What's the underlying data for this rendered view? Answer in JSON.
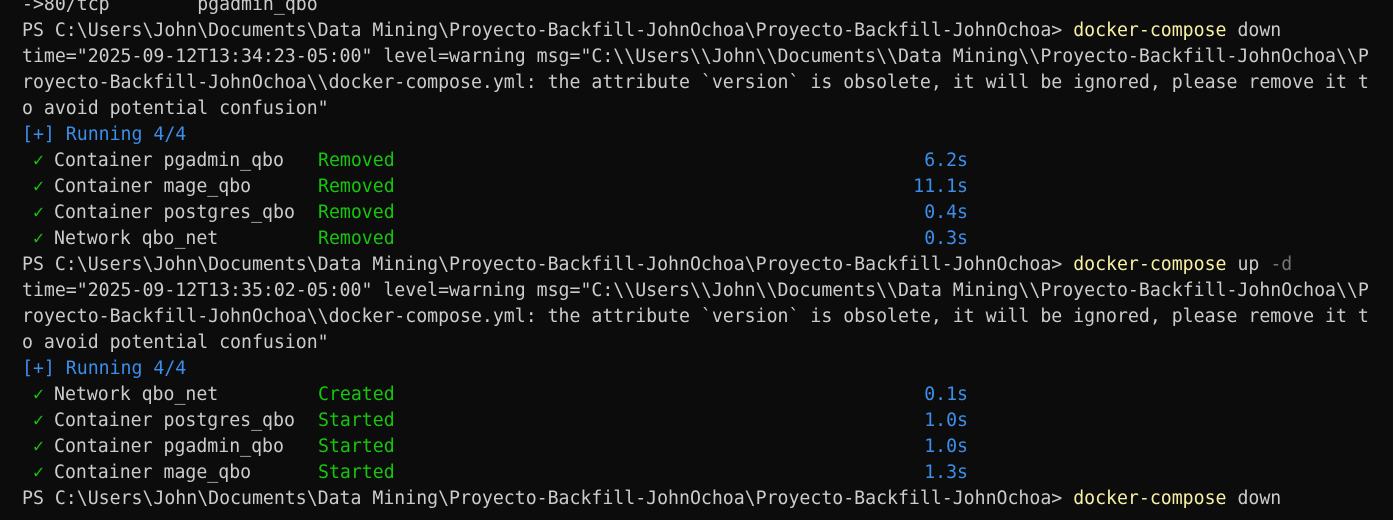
{
  "partial_top": {
    "left": "->80/tcp",
    "right": "pgadmin_qbo"
  },
  "block1": {
    "prompt": "PS C:\\Users\\John\\Documents\\Data Mining\\Proyecto-Backfill-JohnOchoa\\Proyecto-Backfill-JohnOchoa>",
    "cmd": "docker-compose",
    "arg": "down",
    "warn_line1": "time=\"2025-09-12T13:34:23-05:00\" level=warning msg=\"C:\\\\Users\\\\John\\\\Documents\\\\Data Mining\\\\Proyecto-Backfill-JohnOchoa\\\\P",
    "warn_line2": "royecto-Backfill-JohnOchoa\\\\docker-compose.yml: the attribute `version` is obsolete, it will be ignored, please remove it t",
    "warn_line3": "o avoid potential confusion\"",
    "running": "[+] Running 4/4",
    "items": [
      {
        "name": "Container pgadmin_qbo",
        "status": "Removed",
        "time": "6.2s"
      },
      {
        "name": "Container mage_qbo",
        "status": "Removed",
        "time": "11.1s"
      },
      {
        "name": "Container postgres_qbo",
        "status": "Removed",
        "time": "0.4s"
      },
      {
        "name": "Network qbo_net",
        "status": "Removed",
        "time": "0.3s"
      }
    ]
  },
  "block2": {
    "prompt": "PS C:\\Users\\John\\Documents\\Data Mining\\Proyecto-Backfill-JohnOchoa\\Proyecto-Backfill-JohnOchoa>",
    "cmd": "docker-compose",
    "arg": "up",
    "flag": "-d",
    "warn_line1": "time=\"2025-09-12T13:35:02-05:00\" level=warning msg=\"C:\\\\Users\\\\John\\\\Documents\\\\Data Mining\\\\Proyecto-Backfill-JohnOchoa\\\\P",
    "warn_line2": "royecto-Backfill-JohnOchoa\\\\docker-compose.yml: the attribute `version` is obsolete, it will be ignored, please remove it t",
    "warn_line3": "o avoid potential confusion\"",
    "running": "[+] Running 4/4",
    "items": [
      {
        "name": "Network qbo_net",
        "status": "Created",
        "time": "0.1s"
      },
      {
        "name": "Container postgres_qbo",
        "status": "Started",
        "time": "1.0s"
      },
      {
        "name": "Container pgadmin_qbo",
        "status": "Started",
        "time": "1.0s"
      },
      {
        "name": "Container mage_qbo",
        "status": "Started",
        "time": "1.3s"
      }
    ]
  },
  "block3": {
    "prompt": "PS C:\\Users\\John\\Documents\\Data Mining\\Proyecto-Backfill-JohnOchoa\\Proyecto-Backfill-JohnOchoa>",
    "cmd": "docker-compose",
    "arg": "down"
  },
  "check_glyph": "✓",
  "colors": {
    "background": "#0c0c0c",
    "text": "#cccccc",
    "command": "#f9f1a5",
    "running": "#3b8eea",
    "success": "#16c60c",
    "flag": "#767676"
  }
}
